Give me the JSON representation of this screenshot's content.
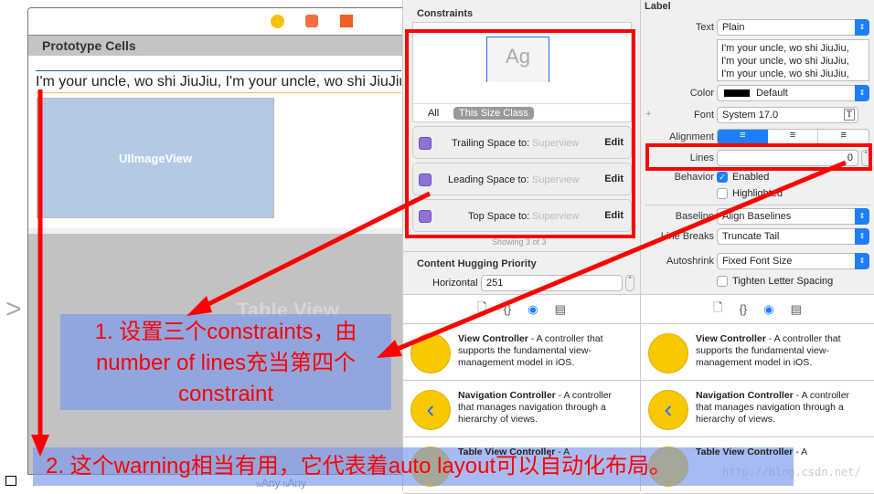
{
  "canvas": {
    "prototype_cells": "Prototype Cells",
    "label_text": "I'm your uncle, wo shi JiuJiu, I'm your uncle, wo shi JiuJiu,",
    "image_view": "UIImageView",
    "table_view": "Table View",
    "size_class": "wAny hAny",
    "size_w": "w",
    "size_w_val": "Any",
    "size_h": "h",
    "size_h_val": "Any"
  },
  "constraints": {
    "title": "Constraints",
    "preview_text": "Ag",
    "tab_all": "All",
    "tab_size_class": "This Size Class",
    "items": [
      {
        "label": "Trailing Space to:",
        "target": "Superview",
        "action": "Edit"
      },
      {
        "label": "Leading Space to:",
        "target": "Superview",
        "action": "Edit"
      },
      {
        "label": "Top Space to:",
        "target": "Superview",
        "action": "Edit"
      }
    ],
    "showing": "Showing 3 of 3",
    "hugging_title": "Content Hugging Priority",
    "horizontal_label": "Horizontal",
    "horizontal_value": "251"
  },
  "label_inspector": {
    "title": "Label",
    "text_label": "Text",
    "text_value": "Plain",
    "text_content": [
      "I'm your uncle, wo shi JiuJiu,",
      "I'm your uncle, wo shi JiuJiu,",
      "I'm your uncle, wo shi JiuJiu,"
    ],
    "color_label": "Color",
    "color_value": "Default",
    "font_label": "Font",
    "font_value": "System 17.0",
    "alignment_label": "Alignment",
    "lines_label": "Lines",
    "lines_value": "0",
    "behavior_label": "Behavior",
    "enabled": "Enabled",
    "enabled_checked": true,
    "highlighted": "Highlighted",
    "highlighted_checked": false,
    "baseline_label": "Baseline",
    "baseline_value": "Align Baselines",
    "linebreaks_label": "Line Breaks",
    "linebreaks_value": "Truncate Tail",
    "autoshrink_label": "Autoshrink",
    "autoshrink_value": "Fixed Font Size",
    "tighten": "Tighten Letter Spacing",
    "tighten_checked": false
  },
  "library": {
    "items": [
      {
        "name": "View Controller",
        "desc": " - A controller that supports the fundamental view-management model in iOS."
      },
      {
        "name": "Navigation Controller",
        "desc": " - A controller that manages navigation through a hierarchy of views."
      },
      {
        "name": "Table View Controller",
        "desc": " - A"
      }
    ]
  },
  "annotations": {
    "note1": "1. 设置三个constraints，由number of lines充当第四个constraint",
    "note2": "2. 这个warning相当有用，它代表着auto layout可以自动化布局。",
    "watermark": "http://blog.csdn.net/"
  },
  "colors": {
    "accent": "#1e7ef7",
    "annotation": "#ff0000",
    "constraint_icon": "#8e72d8"
  }
}
